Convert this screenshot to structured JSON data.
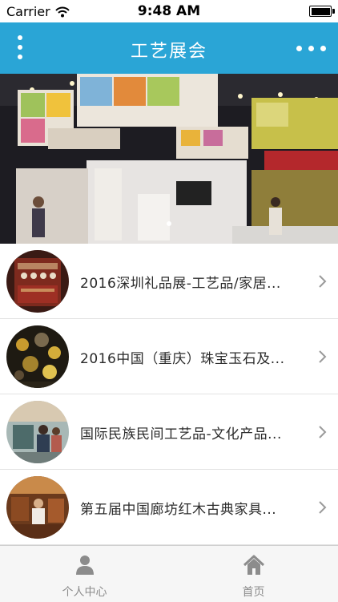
{
  "status": {
    "carrier": "Carrier",
    "time": "9:48 AM",
    "battery_level": 1.0
  },
  "header": {
    "title": "工艺展会"
  },
  "banner": {
    "slide_count": 1,
    "active_slide": 0
  },
  "list": {
    "items": [
      {
        "title": "2016深圳礼品展-工艺品/家居..."
      },
      {
        "title": "2016中国（重庆）珠宝玉石及..."
      },
      {
        "title": "国际民族民间工艺品-文化产品..."
      },
      {
        "title": "第五届中国廊坊红木古典家具..."
      }
    ]
  },
  "tabbar": {
    "tabs": [
      {
        "label": "个人中心",
        "icon": "person-icon"
      },
      {
        "label": "首页",
        "icon": "home-icon"
      }
    ]
  },
  "colors": {
    "accent": "#2aa5d6",
    "tab_icon": "#8c8c8c"
  }
}
